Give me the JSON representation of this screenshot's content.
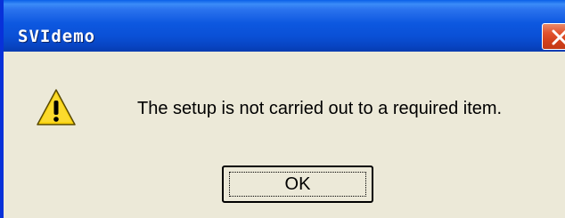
{
  "window": {
    "title": "SVIdemo"
  },
  "dialog": {
    "icon": "warning-icon",
    "message": "The setup is not carried out to a required item."
  },
  "buttons": {
    "ok_label": "OK",
    "close_icon": "close-icon"
  },
  "colors": {
    "titlebar": "#0a50d6",
    "close_button": "#d2401a",
    "dialog_background": "#ece9d8",
    "warning_yellow": "#f7d211"
  }
}
